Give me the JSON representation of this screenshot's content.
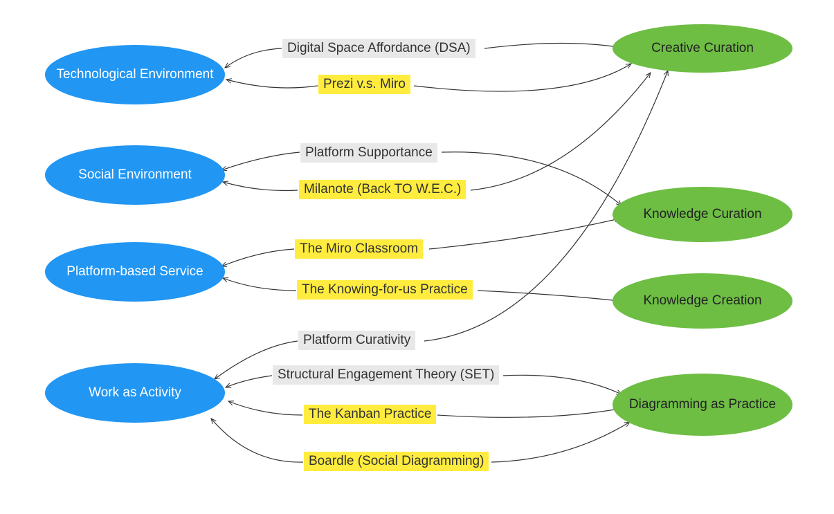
{
  "leftNodes": {
    "techEnv": "Technological Environment",
    "socialEnv": "Social Environment",
    "platformService": "Platform-based Service",
    "workActivity": "Work as Activity"
  },
  "rightNodes": {
    "creativeCuration": "Creative Curation",
    "knowledgeCuration": "Knowledge Curation",
    "knowledgeCreation": "Knowledge Creation",
    "diagrammingPractice": "Diagramming as Practice"
  },
  "labels": {
    "dsa": "Digital Space Affordance (DSA)",
    "preziMiro": "Prezi v.s. Miro",
    "platformSupportance": "Platform Supportance",
    "milanote": "Milanote (Back TO W.E.C.)",
    "miroClassroom": "The Miro Classroom",
    "knowingForUs": "The Knowing-for-us Practice",
    "platformCurativity": "Platform Curativity",
    "set": "Structural Engagement Theory (SET)",
    "kanbanPractice": "The Kanban Practice",
    "boardle": "Boardle (Social Diagramming)"
  },
  "connections": [
    {
      "from": "dsa",
      "to": "techEnv",
      "arrow": "to"
    },
    {
      "from": "dsa",
      "to": "creativeCuration",
      "arrow": "to"
    },
    {
      "from": "preziMiro",
      "to": "techEnv",
      "arrow": "to"
    },
    {
      "from": "preziMiro",
      "to": "creativeCuration",
      "arrow": "to"
    },
    {
      "from": "platformSupportance",
      "to": "socialEnv",
      "arrow": "to"
    },
    {
      "from": "platformSupportance",
      "to": "knowledgeCuration",
      "arrow": "to"
    },
    {
      "from": "milanote",
      "to": "socialEnv",
      "arrow": "to"
    },
    {
      "from": "milanote",
      "to": "creativeCuration",
      "arrow": "to"
    },
    {
      "from": "miroClassroom",
      "to": "platformService",
      "arrow": "to"
    },
    {
      "from": "miroClassroom",
      "to": "knowledgeCuration",
      "arrow": "to"
    },
    {
      "from": "knowingForUs",
      "to": "platformService",
      "arrow": "to"
    },
    {
      "from": "knowingForUs",
      "to": "knowledgeCreation",
      "arrow": "to"
    },
    {
      "from": "platformCurativity",
      "to": "workActivity",
      "arrow": "to"
    },
    {
      "from": "platformCurativity",
      "to": "creativeCuration",
      "arrow": "to"
    },
    {
      "from": "set",
      "to": "workActivity",
      "arrow": "to"
    },
    {
      "from": "set",
      "to": "diagrammingPractice",
      "arrow": "to"
    },
    {
      "from": "kanbanPractice",
      "to": "workActivity",
      "arrow": "to"
    },
    {
      "from": "kanbanPractice",
      "to": "diagrammingPractice",
      "arrow": "to"
    },
    {
      "from": "boardle",
      "to": "workActivity",
      "arrow": "to"
    },
    {
      "from": "boardle",
      "to": "diagrammingPractice",
      "arrow": "to"
    }
  ]
}
